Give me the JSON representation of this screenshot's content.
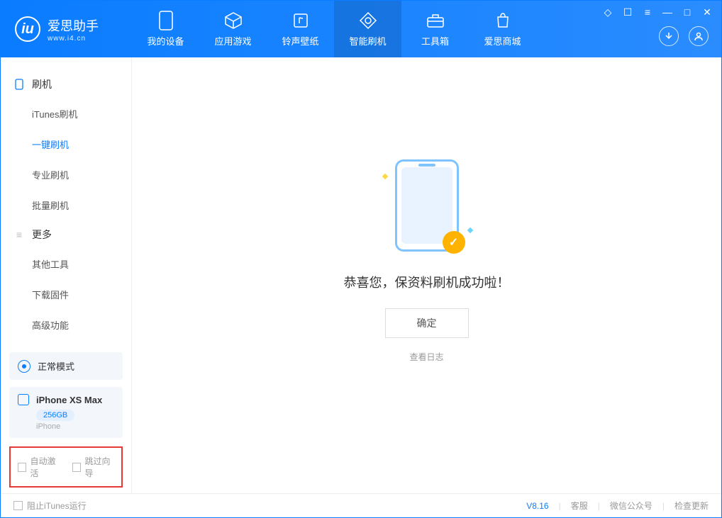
{
  "header": {
    "app_name": "爱思助手",
    "app_url": "www.i4.cn",
    "nav": [
      {
        "label": "我的设备",
        "icon": "device-icon"
      },
      {
        "label": "应用游戏",
        "icon": "cube-icon"
      },
      {
        "label": "铃声壁纸",
        "icon": "music-icon"
      },
      {
        "label": "智能刷机",
        "icon": "refresh-icon"
      },
      {
        "label": "工具箱",
        "icon": "toolbox-icon"
      },
      {
        "label": "爱思商城",
        "icon": "shop-icon"
      }
    ],
    "active_nav_index": 3
  },
  "sidebar": {
    "sections": [
      {
        "title": "刷机",
        "icon": "phone-icon",
        "items": [
          "iTunes刷机",
          "一键刷机",
          "专业刷机",
          "批量刷机"
        ],
        "active_index": 1
      },
      {
        "title": "更多",
        "icon": "menu-icon",
        "items": [
          "其他工具",
          "下载固件",
          "高级功能"
        ],
        "active_index": -1
      }
    ],
    "mode_label": "正常模式",
    "device": {
      "name": "iPhone XS Max",
      "storage": "256GB",
      "type": "iPhone"
    },
    "checks": {
      "auto_activate": "自动激活",
      "skip_guide": "跳过向导"
    }
  },
  "main": {
    "success_message": "恭喜您，保资料刷机成功啦！",
    "ok_button": "确定",
    "view_log": "查看日志"
  },
  "footer": {
    "block_itunes": "阻止iTunes运行",
    "version": "V8.16",
    "links": [
      "客服",
      "微信公众号",
      "检查更新"
    ]
  },
  "colors": {
    "primary": "#0a7cff",
    "accent": "#ffb300"
  }
}
